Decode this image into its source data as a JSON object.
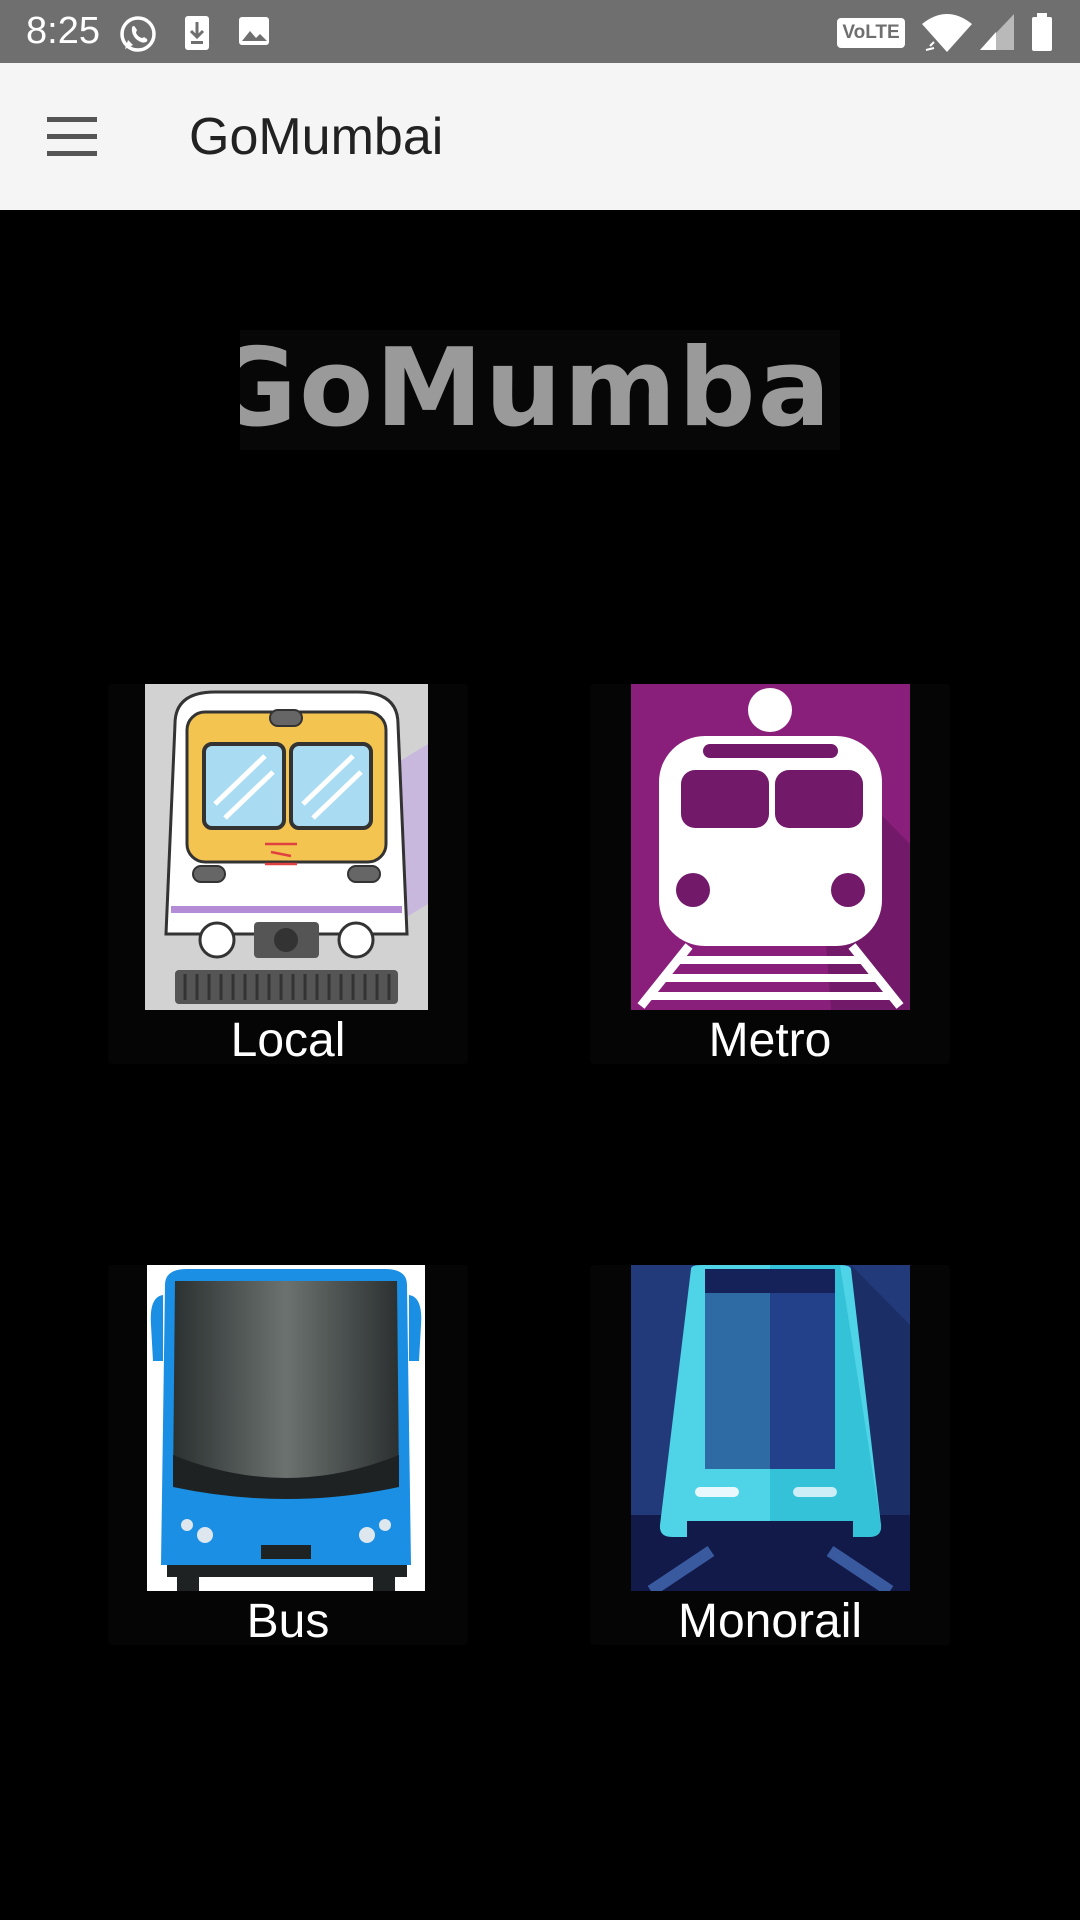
{
  "status_bar": {
    "time": "8:25",
    "network_badge": "VoLTE",
    "icons": [
      "whatsapp-icon",
      "download-icon",
      "image-icon",
      "volte-icon",
      "wifi-icon",
      "signal-icon",
      "battery-icon"
    ],
    "bg_color": "#6f6f6f"
  },
  "app_bar": {
    "menu_icon": "hamburger-menu-icon",
    "title": "GoMumbai",
    "bg_color": "#f5f5f5"
  },
  "logo": {
    "text": "GoMumbai"
  },
  "transport_options": [
    {
      "label": "Local",
      "icon": "local-train-icon",
      "accent": "#f5c14e"
    },
    {
      "label": "Metro",
      "icon": "metro-train-icon",
      "accent": "#8a1f7b"
    },
    {
      "label": "Bus",
      "icon": "bus-icon",
      "accent": "#1a8fe3"
    },
    {
      "label": "Monorail",
      "icon": "monorail-icon",
      "accent": "#4fd3e6"
    }
  ]
}
